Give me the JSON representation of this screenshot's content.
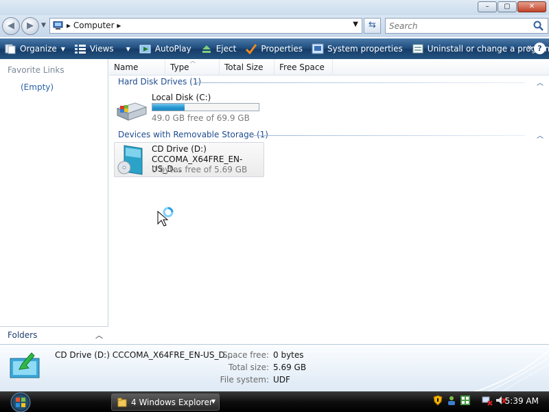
{
  "window": {
    "minimize": "–",
    "maximize": "▢",
    "close": "✕"
  },
  "address": {
    "crumb": "Computer",
    "search_placeholder": "Search"
  },
  "toolbar": {
    "organize": "Organize",
    "views": "Views",
    "autoplay": "AutoPlay",
    "eject": "Eject",
    "properties": "Properties",
    "system_properties": "System properties",
    "uninstall": "Uninstall or change a program",
    "more": "»",
    "help": "?"
  },
  "sidebar": {
    "title": "Favorite Links",
    "empty": "(Empty)",
    "folders": "Folders"
  },
  "columns": [
    "Name",
    "Type",
    "Total Size",
    "Free Space"
  ],
  "groups": {
    "hdd": "Hard Disk Drives (1)",
    "removable": "Devices with Removable Storage (1)"
  },
  "drives": {
    "c": {
      "name": "Local Disk (C:)",
      "free": "49.0 GB free of 69.9 GB",
      "used_fraction": 0.3
    },
    "d": {
      "name": "CD Drive (D:)",
      "label": "CCCOMA_X64FRE_EN-US_D...",
      "free": "0 bytes free of 5.69 GB"
    }
  },
  "details": {
    "title": "CD Drive (D:) CCCOMA_X64FRE_EN-US_D...",
    "space_free_label": "Space free:",
    "space_free": "0 bytes",
    "total_size_label": "Total size:",
    "total_size": "5.69 GB",
    "file_system_label": "File system:",
    "file_system": "UDF"
  },
  "taskbar": {
    "task_label": "4 Windows Explorer",
    "clock": "5:39 AM"
  },
  "colors": {
    "toolbar": "#1d4c7d",
    "accent": "#1e4b8f",
    "bar_fill": "#2697d1"
  }
}
